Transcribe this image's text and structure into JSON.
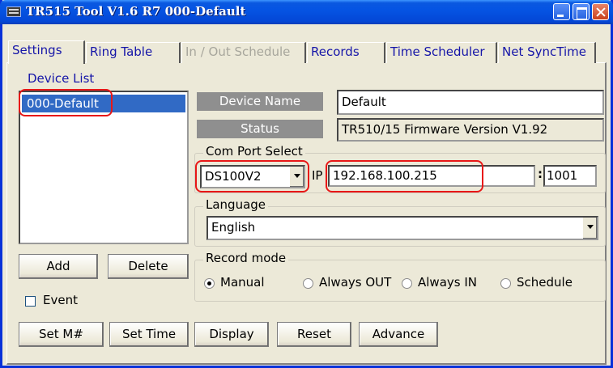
{
  "window": {
    "title": "TR515 Tool V1.6 R7   000-Default"
  },
  "tabs": [
    {
      "label": "Settings",
      "state": "active"
    },
    {
      "label": "Ring Table",
      "state": "normal"
    },
    {
      "label": "In / Out Schedule",
      "state": "disabled"
    },
    {
      "label": "Records",
      "state": "normal"
    },
    {
      "label": "Time Scheduler",
      "state": "normal"
    },
    {
      "label": "Net SyncTime",
      "state": "normal"
    }
  ],
  "device_list": {
    "label": "Device List",
    "items": [
      "000-Default"
    ],
    "selected": "000-Default"
  },
  "buttons": {
    "add": "Add",
    "delete": "Delete",
    "set_m": "Set M#",
    "set_time": "Set Time",
    "display": "Display",
    "reset": "Reset",
    "advance": "Advance"
  },
  "event": {
    "label": "Event",
    "checked": false
  },
  "device_name": {
    "label": "Device Name",
    "value": "Default"
  },
  "status": {
    "label": "Status",
    "value": "TR510/15 Firmware Version V1.92"
  },
  "com_port": {
    "legend": "Com Port Select",
    "port": "DS100V2",
    "ip_label": "IP",
    "ip": "192.168.100.215",
    "port_sep": ":",
    "port_number": "1001"
  },
  "language": {
    "legend": "Language",
    "value": "English"
  },
  "record_mode": {
    "legend": "Record mode",
    "options": [
      "Manual",
      "Always OUT",
      "Always IN",
      "Schedule"
    ],
    "selected": "Manual"
  },
  "colors": {
    "title_bar": "#0554e3",
    "selection": "#316ac5",
    "tab_text": "#1515a8",
    "annotation": "#e81717"
  }
}
